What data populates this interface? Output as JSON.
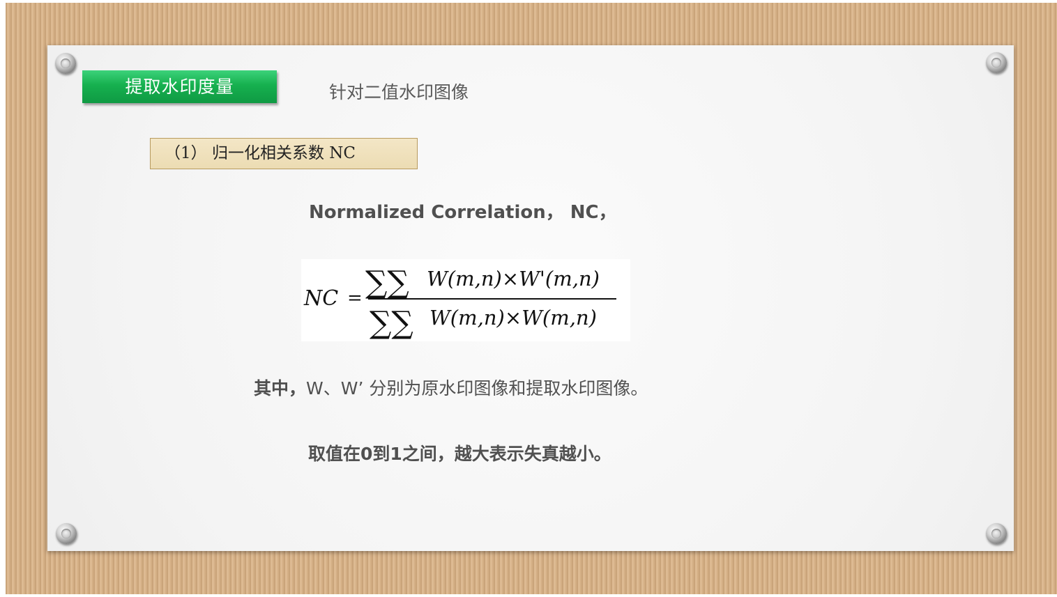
{
  "slide": {
    "tag": "提取水印度量",
    "subtitle": "针对二值水印图像",
    "section_label": "（1） 归一化相关系数 NC",
    "normalized_line": "Normalized Correlation， NC，",
    "formula": {
      "lhs": "NC",
      "equals": "=",
      "sum": "∑∑",
      "numerator": "W(m,n)×W'(m,n)",
      "denominator": "W(m,n)×W(m,n)"
    },
    "note_prefix": "其中，",
    "note_text": "W、W’ 分别为原水印图像和提取水印图像。",
    "range_text": "取值在0到1之间，越大表示失真越小。"
  },
  "colors": {
    "frame": "#d9b48a",
    "paper": "#f7f7f7",
    "tag_green": "#16b04f",
    "section_box": "#ecdcb3",
    "text": "#505050"
  },
  "icons": [
    "grommet-icon",
    "grommet-icon",
    "grommet-icon",
    "grommet-icon"
  ]
}
